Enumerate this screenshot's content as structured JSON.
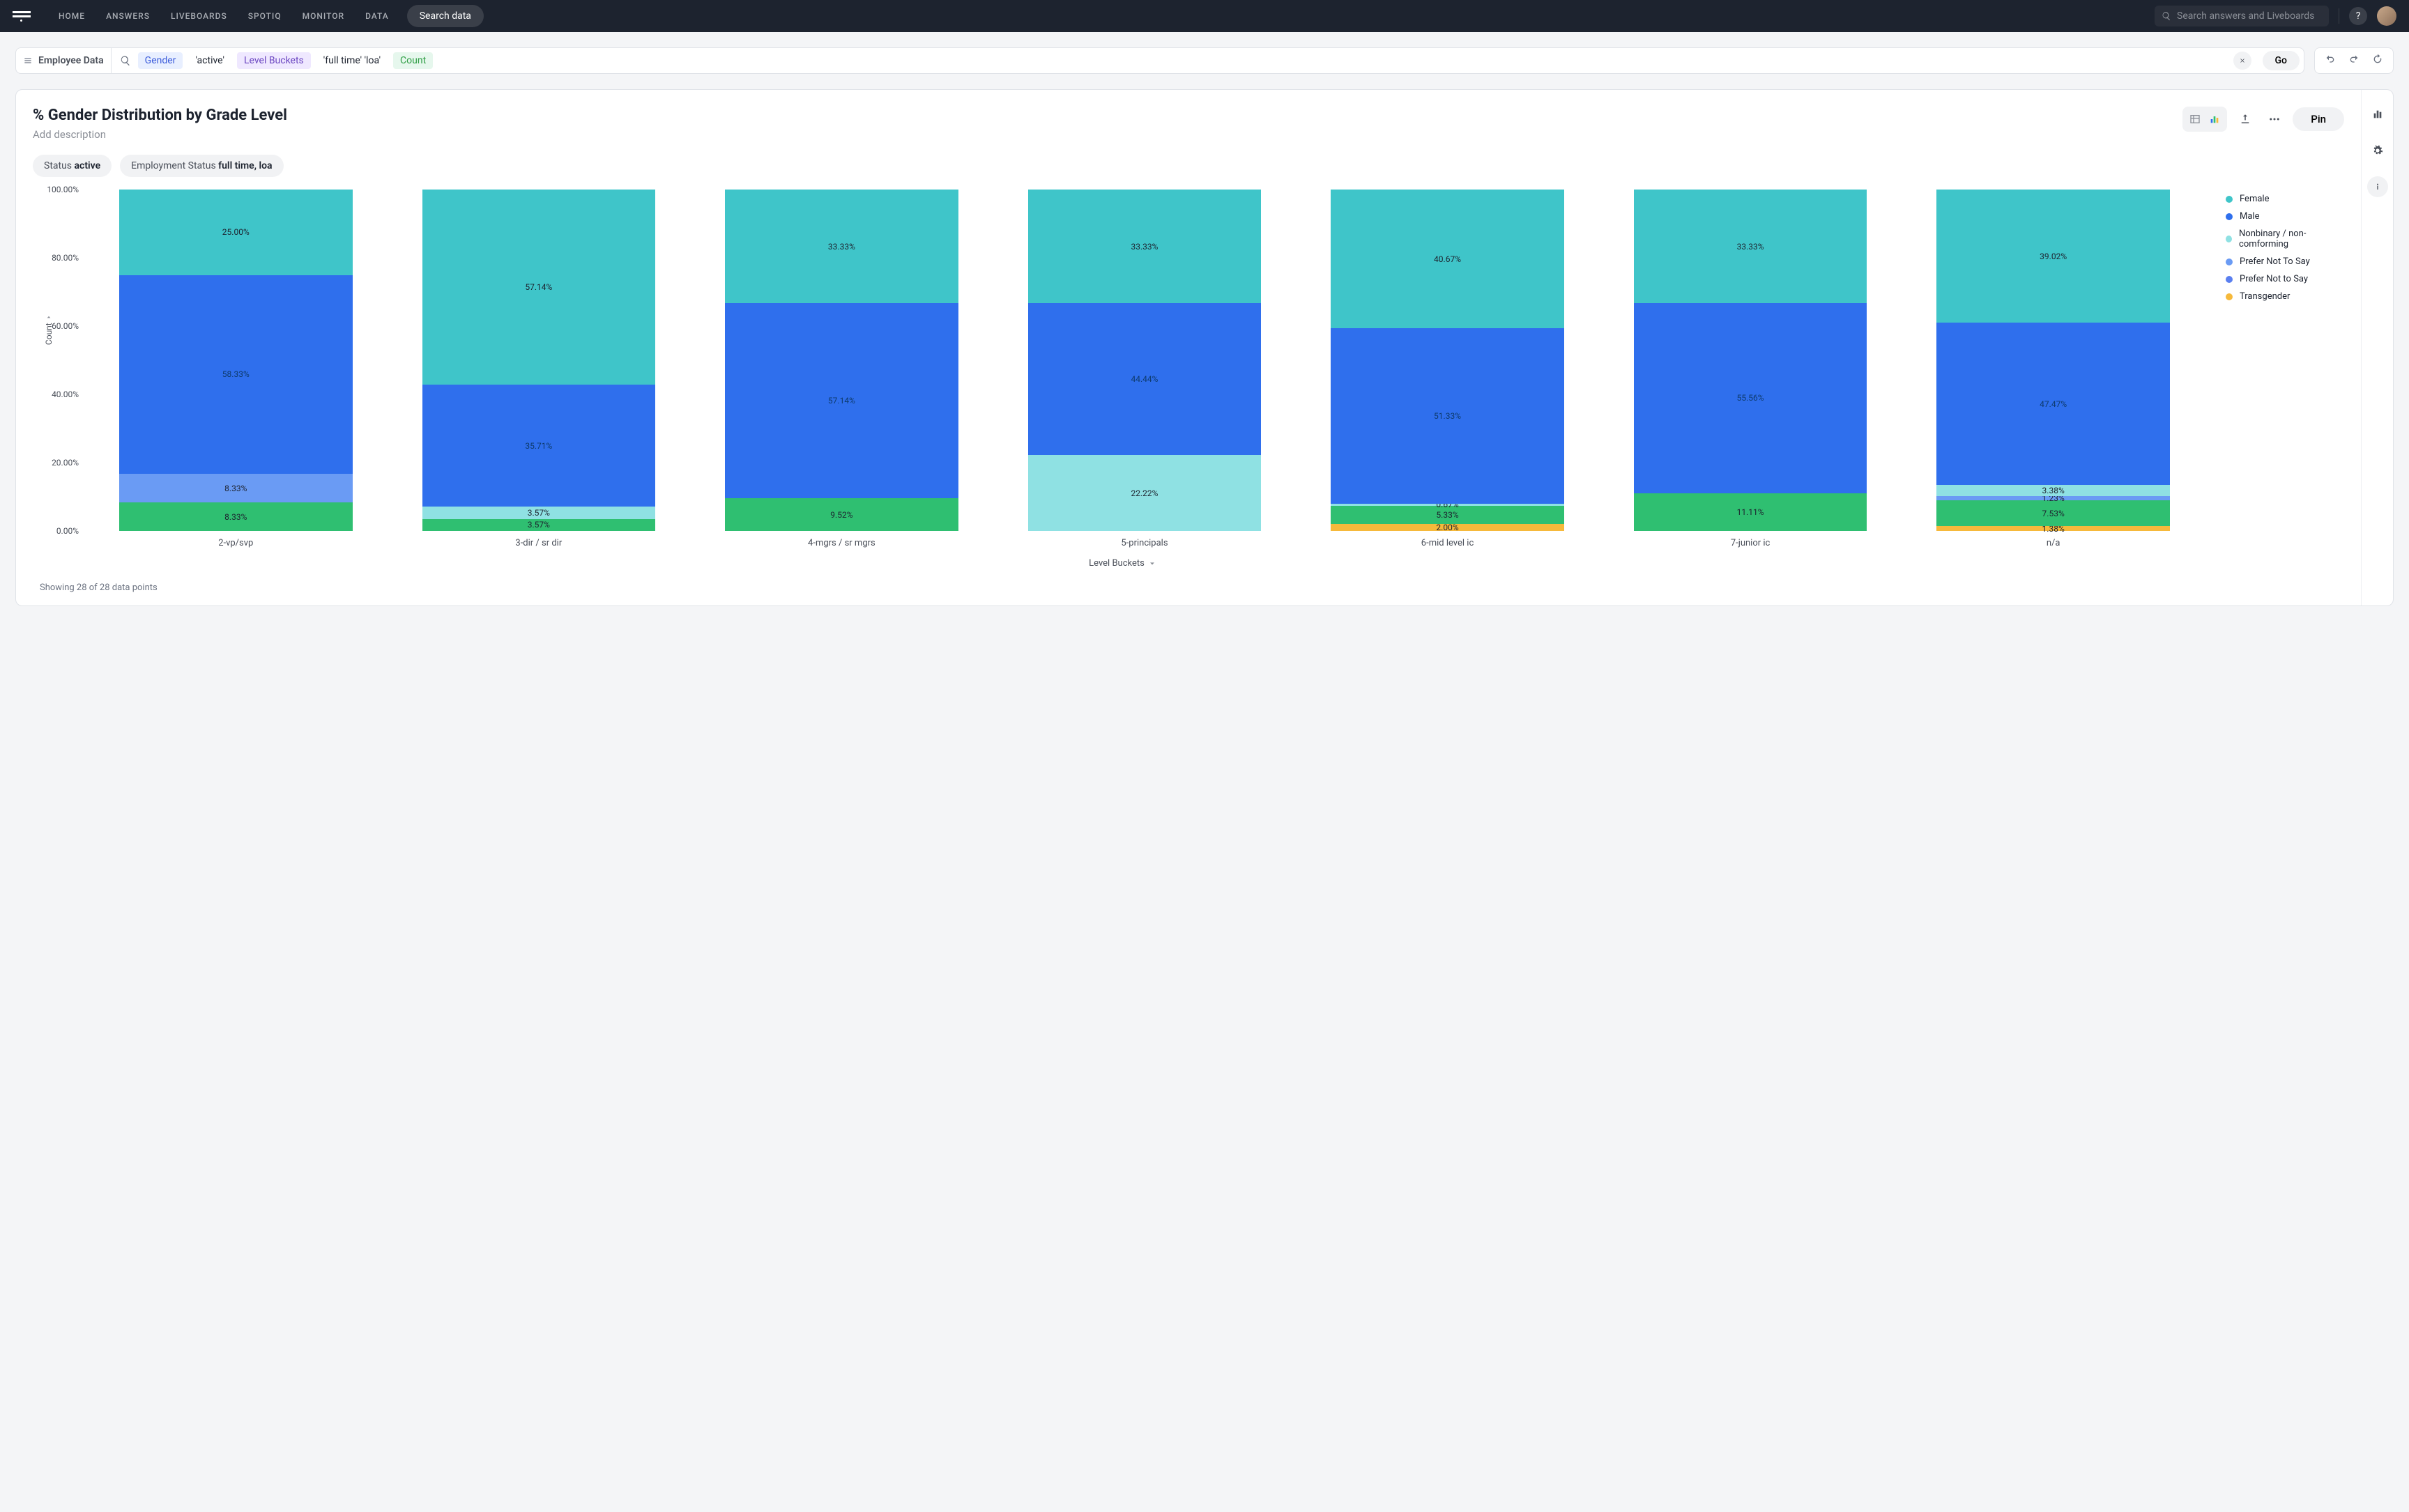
{
  "nav": {
    "items": [
      "HOME",
      "ANSWERS",
      "LIVEBOARDS",
      "SPOTIQ",
      "MONITOR",
      "DATA"
    ],
    "search_data_btn": "Search data",
    "global_search_placeholder": "Search answers and Liveboards",
    "help_label": "?"
  },
  "searchbar": {
    "datasource": "Employee Data",
    "tokens": {
      "gender": "Gender",
      "active": "'active'",
      "level_buckets": "Level Buckets",
      "fulltime_loa": "'full time' 'loa'",
      "count": "Count"
    },
    "go": "Go"
  },
  "panel": {
    "title": "% Gender Distribution by Grade Level",
    "description_placeholder": "Add description",
    "pin": "Pin",
    "filters": {
      "status_label": "Status ",
      "status_value": "active",
      "emp_label": "Employment Status ",
      "emp_value": "full time, loa"
    },
    "footnote": "Showing 28 of 28 data points"
  },
  "chart_data": {
    "type": "bar",
    "stacked": true,
    "percent": true,
    "ylabel": "Count",
    "xlabel": "Level Buckets",
    "ylim": [
      0,
      100
    ],
    "yticks": [
      "0.00%",
      "20.00%",
      "40.00%",
      "60.00%",
      "80.00%",
      "100.00%"
    ],
    "categories": [
      "2-vp/svp",
      "3-dir / sr dir",
      "4-mgrs / sr mgrs",
      "5-principals",
      "6-mid level ic",
      "7-junior ic",
      "n/a"
    ],
    "legend": [
      {
        "name": "Female",
        "color": "#3fc5c9"
      },
      {
        "name": "Male",
        "color": "#2f6fed"
      },
      {
        "name": "Nonbinary / non-comforming",
        "color": "#8fe1e3"
      },
      {
        "name": "Prefer Not To Say",
        "color": "#6a9bf4"
      },
      {
        "name": "Prefer Not to Say",
        "color": "#5a7ff0"
      },
      {
        "name": "Transgender",
        "color": "#f6b93b"
      }
    ],
    "series": [
      {
        "name": "Transgender",
        "color": "#f6b93b",
        "values": [
          0,
          0,
          0,
          0,
          2.0,
          0,
          1.38
        ],
        "labels": [
          "",
          "",
          "",
          "",
          "2.00%",
          "",
          "1.38%"
        ]
      },
      {
        "name": "Prefer Not to Say",
        "color": "#2fbf71",
        "values": [
          8.33,
          3.57,
          9.52,
          0,
          5.33,
          11.11,
          7.53
        ],
        "labels": [
          "8.33%",
          "3.57%",
          "9.52%",
          "",
          "5.33%",
          "11.11%",
          "7.53%"
        ]
      },
      {
        "name": "Prefer Not To Say",
        "color": "#6a9bf4",
        "values": [
          8.33,
          0,
          0,
          0,
          0,
          0,
          1.23
        ],
        "labels": [
          "8.33%",
          "",
          "",
          "",
          "",
          "",
          "1.23%"
        ]
      },
      {
        "name": "Nonbinary / non-comforming",
        "color": "#8fe1e3",
        "values": [
          0,
          3.57,
          0,
          22.22,
          0.67,
          0,
          3.38
        ],
        "labels": [
          "",
          "3.57%",
          "",
          "22.22%",
          "0.67%",
          "",
          "3.38%"
        ]
      },
      {
        "name": "Male",
        "color": "#2f6fed",
        "values": [
          58.33,
          35.71,
          57.14,
          44.44,
          51.33,
          55.56,
          47.47
        ],
        "labels": [
          "58.33%",
          "35.71%",
          "57.14%",
          "44.44%",
          "51.33%",
          "55.56%",
          "47.47%"
        ]
      },
      {
        "name": "Female",
        "color": "#3fc5c9",
        "values": [
          25.0,
          57.14,
          33.33,
          33.33,
          40.67,
          33.33,
          39.02
        ],
        "labels": [
          "25.00%",
          "57.14%",
          "33.33%",
          "33.33%",
          "40.67%",
          "33.33%",
          "39.02%"
        ]
      }
    ]
  }
}
